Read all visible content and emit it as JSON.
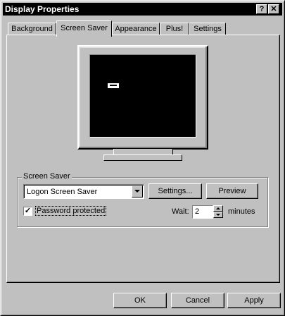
{
  "window": {
    "title": "Display Properties",
    "help_btn": "?",
    "close_btn": "✕"
  },
  "tabs": [
    {
      "label": "Background",
      "active": false
    },
    {
      "label": "Screen Saver",
      "active": true
    },
    {
      "label": "Appearance",
      "active": false
    },
    {
      "label": "Plus!",
      "active": false
    },
    {
      "label": "Settings",
      "active": false
    }
  ],
  "screen_saver": {
    "group_label": "Screen Saver",
    "selected": "Logon Screen Saver",
    "settings_button": "Settings...",
    "preview_button": "Preview",
    "password_label": "Password protected",
    "password_checked": "✓",
    "wait_label": "Wait:",
    "wait_value": "2",
    "minutes_label": "minutes"
  },
  "buttons": {
    "ok": "OK",
    "cancel": "Cancel",
    "apply": "Apply"
  }
}
